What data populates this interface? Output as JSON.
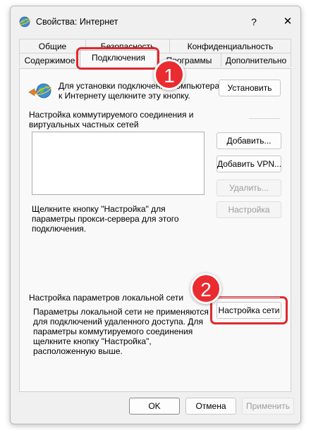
{
  "window": {
    "title": "Свойства: Интернет",
    "help_label": "?",
    "close_label": "✕"
  },
  "tabs": {
    "row1": [
      "Общие",
      "Безопасность",
      "Конфиденциальность"
    ],
    "row2": [
      "Содержимое",
      "Подключения",
      "Программы",
      "Дополнительно"
    ],
    "active": "Подключения"
  },
  "setup": {
    "text": "Для установки подключения компьютера к Интернету щелкните эту кнопку.",
    "button": "Установить"
  },
  "dialup": {
    "heading": "Настройка коммутируемого соединения и виртуальных частных сетей",
    "add_button": "Добавить...",
    "add_vpn_button": "Добавить VPN...",
    "remove_button": "Удалить...",
    "proxy_text": "Щелкните кнопку \"Настройка\" для параметры прокси-сервера для этого подключения.",
    "settings_button": "Настройка"
  },
  "lan": {
    "heading": "Настройка параметров локальной сети",
    "text": "Параметры локальной сети не применяются для подключений удаленного доступа. Для параметры коммутируемого соединения щелкните кнопку \"Настройка\", расположенную выше.",
    "button": "Настройка сети"
  },
  "footer": {
    "ok": "OK",
    "cancel": "Отмена",
    "apply": "Применить"
  },
  "annotations": {
    "step1": "1",
    "step2": "2",
    "color": "#ea2b30"
  }
}
